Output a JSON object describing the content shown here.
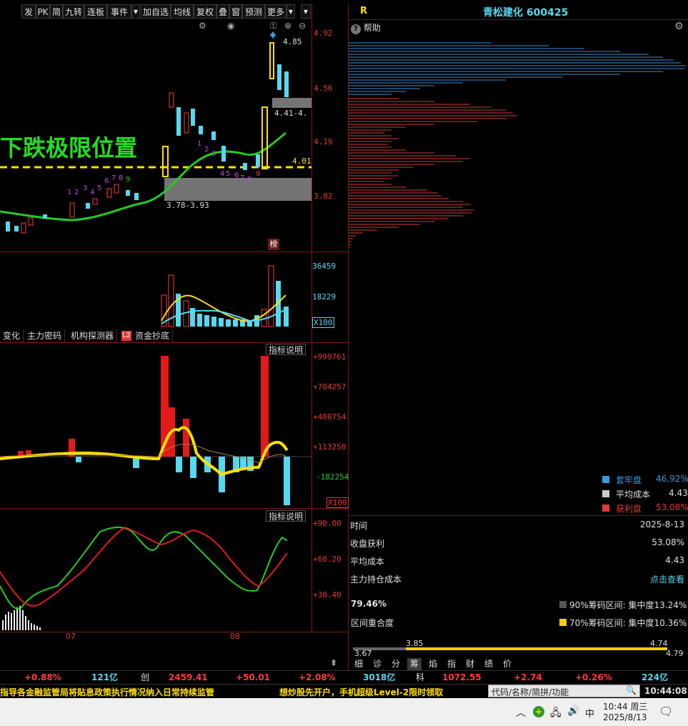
{
  "toolbar": {
    "items": [
      "发",
      "PK",
      "简",
      "九转",
      "连板",
      "事件",
      "加自选",
      "均线",
      "复权",
      "叠",
      "窗",
      "预测",
      "更多"
    ]
  },
  "chart_overlay": {
    "big_text": "下跌极限位置",
    "price_labels": [
      "4.92",
      "4.56",
      "4.19",
      "3.82"
    ],
    "marker_high": "4.85",
    "marker_range_upper": "4.41-4.",
    "marker_range_lower": "3.78-3.93",
    "dashed_level": "4.01",
    "bang_badge": "榜",
    "nine_count_up": [
      "1",
      "2",
      "3",
      "4",
      "5",
      "6",
      "7",
      "8",
      "9"
    ],
    "nine_count_down": [
      "1",
      "2",
      "3",
      "4",
      "5",
      "6",
      "7",
      "8",
      "9"
    ]
  },
  "volume_panel": {
    "labels": [
      "36459",
      "18229"
    ],
    "unit": "X100"
  },
  "indicator_tabs": [
    "变化",
    "主力密码",
    "机构探测器",
    "资金抄底"
  ],
  "indicator_tab_badge": "L2",
  "funds_panel": {
    "explain_label": "指标说明",
    "labels": [
      "+999761",
      "+704257",
      "+408754",
      "+113250",
      "-182254"
    ],
    "unit": "X100"
  },
  "kdj_panel": {
    "explain_label": "指标说明",
    "labels": [
      "+90.00",
      "+60.20",
      "+30.40"
    ],
    "months": [
      "07",
      "08"
    ]
  },
  "right_panel": {
    "r_label": "R",
    "stock_title": "青松建化 600425",
    "help_label": "帮助",
    "legend": [
      {
        "label": "套牢盘",
        "value": "46.92%",
        "color": "#3a9ad9"
      },
      {
        "label": "平均成本",
        "value": "4.43",
        "color": "#cccccc"
      },
      {
        "label": "获利盘",
        "value": "53.08%",
        "color": "#e23a3a"
      }
    ],
    "rows": [
      {
        "label": "时间",
        "value": "2025-8-13"
      },
      {
        "label": "收盘获利",
        "value": "53.08%"
      },
      {
        "label": "平均成本",
        "value": "4.43"
      },
      {
        "label": "主力持仓成本",
        "value": "点击查看"
      }
    ],
    "overlap_pct": "79.46%",
    "overlap_label": "区间重合度",
    "range90": "90%筹码区间: 集中度13.24%",
    "range70": "70%筹码区间: 集中度10.36%",
    "range_scale": {
      "low": "3.67",
      "mid_low": "3.85",
      "mid_high": "4.74",
      "high": "4.79"
    },
    "bottom_tabs": [
      "细",
      "诊",
      "分",
      "筹",
      "焰",
      "指",
      "财",
      "绩",
      "价"
    ]
  },
  "ticker": [
    {
      "text": "+0.88%",
      "cls": "red"
    },
    {
      "text": "121亿",
      "cls": "cyan"
    },
    {
      "text": "创",
      "cls": "white"
    },
    {
      "text": "2459.41",
      "cls": "red"
    },
    {
      "text": "+50.01",
      "cls": "red"
    },
    {
      "text": "+2.08%",
      "cls": "red"
    },
    {
      "text": "3018亿",
      "cls": "cyan"
    },
    {
      "text": "科",
      "cls": "white"
    },
    {
      "text": "1072.55",
      "cls": "red"
    },
    {
      "text": "+2.74",
      "cls": "red"
    },
    {
      "text": "+0.26%",
      "cls": "red"
    },
    {
      "text": "224亿",
      "cls": "cyan"
    }
  ],
  "news_bar": {
    "left": "指导各金融监管局将贴息政策执行情况纳入日常持续监管",
    "right": "想炒股先开户，手机超级Level-2限时领取",
    "search_placeholder": "代码/名称/简拼/功能",
    "time": "10:44:08"
  },
  "taskbar": {
    "ime": "中",
    "clock_time": "10:44 周三",
    "clock_date": "2025/8/13"
  }
}
